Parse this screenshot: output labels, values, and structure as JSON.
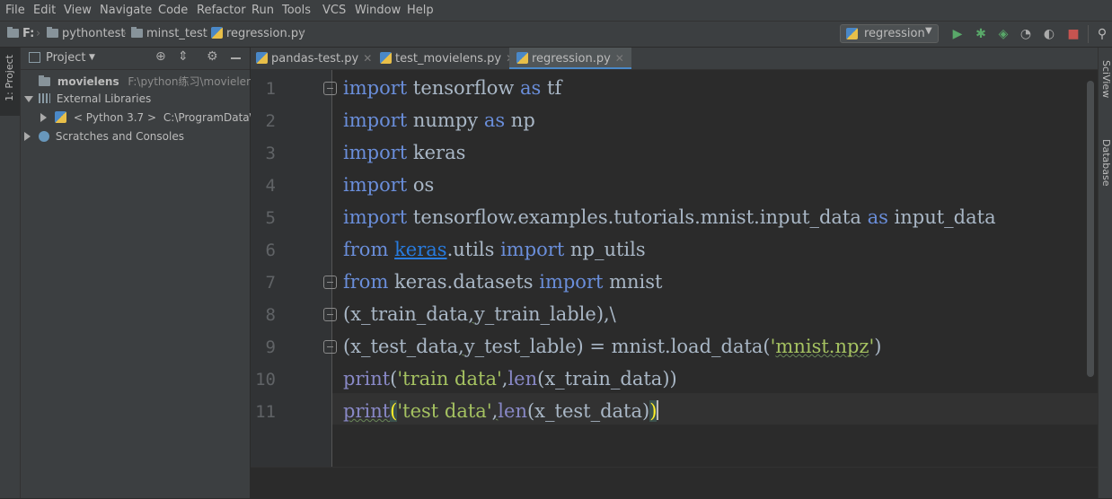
{
  "menu": [
    "File",
    "Edit",
    "View",
    "Navigate",
    "Code",
    "Refactor",
    "Run",
    "Tools",
    "VCS",
    "Window",
    "Help"
  ],
  "breadcrumbs": [
    "F:",
    "pythontest",
    "minst_test",
    "regression.py"
  ],
  "run_config": "regression",
  "left_stripe_label": "1: Project",
  "right_stripe": [
    "SciView",
    "Database"
  ],
  "project": {
    "title": "Project",
    "root_name": "movielens",
    "root_path": "F:\\python练习\\movielens",
    "external_libraries": "External Libraries",
    "python_sdk": "< Python 3.7 >",
    "python_path": "C:\\ProgramData\\A",
    "scratches": "Scratches and Consoles"
  },
  "tabs": [
    {
      "label": "pandas-test.py",
      "active": false
    },
    {
      "label": "test_movielens.py",
      "active": false
    },
    {
      "label": "regression.py",
      "active": true
    }
  ],
  "line_numbers": [
    "1",
    "2",
    "3",
    "4",
    "5",
    "6",
    "7",
    "8",
    "9",
    "10",
    "11"
  ],
  "code": {
    "l1": [
      "import",
      " tensorflow ",
      "as",
      " tf"
    ],
    "l2": [
      "import",
      " numpy ",
      "as",
      " np"
    ],
    "l3": [
      "import",
      " keras"
    ],
    "l4": [
      "import",
      " os"
    ],
    "l5": [
      "import",
      " tensorflow.examples.tutorials.mnist.input_data ",
      "as",
      " input_data"
    ],
    "l6": [
      "from",
      " ",
      "keras",
      ".utils ",
      "import",
      " np_utils"
    ],
    "l7": [
      "from",
      " keras.datasets ",
      "import",
      " mnist"
    ],
    "l8": [
      "(x_train_data",
      ",",
      "y_train_lable),\\"
    ],
    "l9": [
      "(x_test_data",
      ",",
      "y_test_lable) = mnist.load_data(",
      "'",
      "mnist.npz",
      "'",
      ")"
    ],
    "l10": [
      "print",
      "(",
      "'train data'",
      ",",
      "len",
      "(x_train_data))"
    ],
    "l11": [
      "print",
      "(",
      "'test data'",
      ",",
      "len",
      "(x_test_data)",
      ")"
    ]
  },
  "colors": {
    "keyword": "#6a8eda",
    "string": "#a5c261",
    "builtin": "#8888c6",
    "text": "#a9b7c6",
    "background": "#2b2b2b"
  }
}
